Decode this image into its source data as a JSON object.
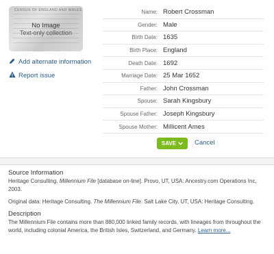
{
  "image": {
    "header": "CENSUS OF ENGLAND AND WALES",
    "no_image": "No Image",
    "text_only": "Text-only collection"
  },
  "links": {
    "alternate": "Add alternate information",
    "report": "Report issue"
  },
  "fields": [
    {
      "label": "Name:",
      "value": "Robert Crossman"
    },
    {
      "label": "Gender:",
      "value": "Male"
    },
    {
      "label": "Birth Date:",
      "value": "1635"
    },
    {
      "label": "Birth Place:",
      "value": "England"
    },
    {
      "label": "Death Date:",
      "value": "1692"
    },
    {
      "label": "Marriage Date:",
      "value": "25 Mar 1652"
    },
    {
      "label": "Father:",
      "value": "John Crossman"
    },
    {
      "label": "Spouse:",
      "value": "Sarah Kingsbury"
    },
    {
      "label": "Spouse Father:",
      "value": "Joseph Kingsbury"
    },
    {
      "label": "Spouse Mother:",
      "value": "Millicent Ames"
    }
  ],
  "actions": {
    "save": "SAVE",
    "cancel": "Cancel"
  },
  "source": {
    "heading": "Source Information",
    "citation_pre": "Heritage Consulting. ",
    "citation_italic": "Millennium File",
    "citation_post": " [database on-line]. Provo, UT, USA: Ancestry.com Operations Inc, 2003.",
    "original_pre": "Original data: Heritage Consulting. ",
    "original_italic": "The Millennium File",
    "original_post": ". Salt Lake City, UT, USA: Heritage Consulting.",
    "desc_heading": "Description",
    "description": "The Millennium File contains more than 880,000 linked family records, with lineages from throughout the world, including colonial America, the British Isles, Switzerland, and Germany. ",
    "learn_more": "Learn more..."
  },
  "colors": {
    "accent": "#7cbb1f",
    "link": "#2a5d8a"
  }
}
